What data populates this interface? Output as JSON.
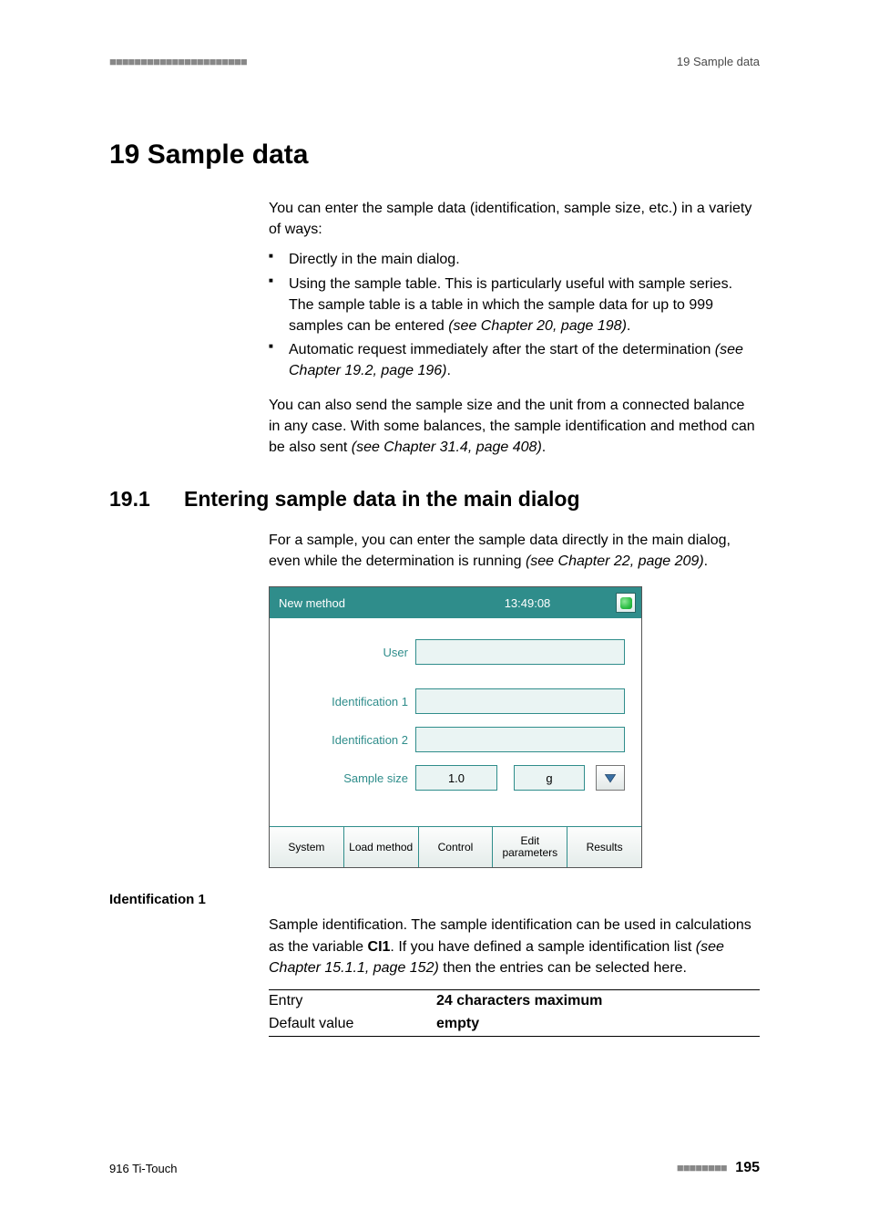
{
  "header": {
    "right": "19 Sample data",
    "dashes": "■■■■■■■■■■■■■■■■■■■■■■"
  },
  "chapter": {
    "title": "19 Sample data"
  },
  "intro": "You can enter the sample data (identification, sample size, etc.) in a variety of ways:",
  "bullets": {
    "b1": "Directly in the main dialog.",
    "b2": "Using the sample table. This is particularly useful with sample series. The sample table is a table in which the sample data for up to 999 samples can be entered ",
    "b2ref": "(see Chapter 20, page 198)",
    "b2end": ".",
    "b3": "Automatic request immediately after the start of the determination ",
    "b3ref": "(see Chapter 19.2, page 196)",
    "b3end": "."
  },
  "para2a": "You can also send the sample size and the unit from a connected balance in any case. With some balances, the sample identification and method can be also sent ",
  "para2ref": "(see Chapter 31.4, page 408)",
  "para2end": ".",
  "section": {
    "num": "19.1",
    "title": "Entering sample data in the main dialog"
  },
  "section_intro_a": "For a sample, you can enter the sample data directly in the main dialog, even while the determination is running ",
  "section_intro_ref": "(see Chapter 22, page 209)",
  "section_intro_end": ".",
  "device": {
    "title": "New method",
    "clock": "13:49:08",
    "labels": {
      "user": "User",
      "id1": "Identification 1",
      "id2": "Identification 2",
      "size": "Sample size"
    },
    "values": {
      "user": "",
      "id1": "",
      "id2": "",
      "size": "1.0",
      "unit": "g"
    },
    "buttons": {
      "b1": "System",
      "b2": "Load method",
      "b3": "Control",
      "b4": "Edit parameters",
      "b5": "Results"
    }
  },
  "field": {
    "name": "Identification 1",
    "desc_a": "Sample identification. The sample identification can be used in calculations as the variable ",
    "desc_var": "CI1",
    "desc_b": ". If you have defined a sample identification list ",
    "desc_ref": "(see Chapter 15.1.1, page 152)",
    "desc_c": " then the entries can be selected here.",
    "entry_k": "Entry",
    "entry_v": "24 characters maximum",
    "default_k": "Default value",
    "default_v": "empty"
  },
  "footer": {
    "left": "916 Ti-Touch",
    "dashes": "■■■■■■■■",
    "page": "195"
  }
}
